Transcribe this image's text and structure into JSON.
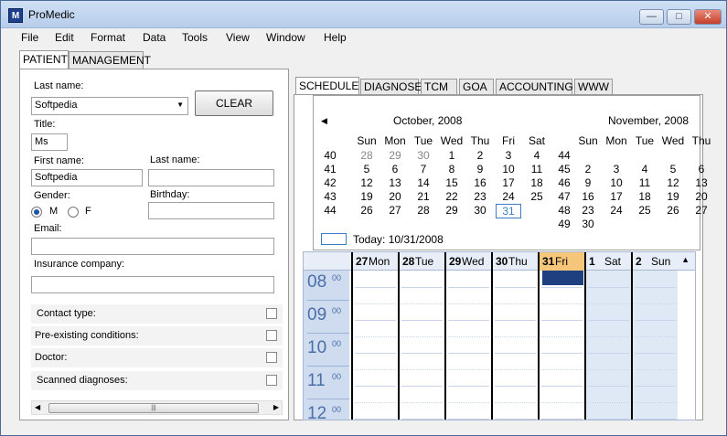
{
  "window": {
    "title": "ProMedic",
    "icon_letter": "M"
  },
  "menu": [
    "File",
    "Edit",
    "Format",
    "Data",
    "Tools",
    "View",
    "Window",
    "Help"
  ],
  "left_tabs": [
    "PATIENT",
    "MANAGEMENT"
  ],
  "patient": {
    "last_name_label": "Last name:",
    "last_name_value": "Softpedia",
    "clear_label": "CLEAR",
    "title_label": "Title:",
    "title_value": "Ms",
    "first_name_label": "First name:",
    "first_name_value": "Softpedia",
    "last_name2_label": "Last name:",
    "gender_label": "Gender:",
    "gender_m": "M",
    "gender_f": "F",
    "birthday_label": "Birthday:",
    "email_label": "Email:",
    "insurance_label": "Insurance company:",
    "contact_type": "Contact type:",
    "preexisting": "Pre-existing conditions:",
    "doctor": "Doctor:",
    "scanned": "Scanned diagnoses:"
  },
  "right_tabs": [
    "SCHEDULE",
    "DIAGNOSE",
    "TCM",
    "GOA",
    "ACCOUNTING",
    "WWW"
  ],
  "calendar": {
    "month1": "October, 2008",
    "month2": "November, 2008",
    "day_headers": [
      "Sun",
      "Mon",
      "Tue",
      "Wed",
      "Thu",
      "Fri",
      "Sat"
    ],
    "day_headers2": [
      "Sun",
      "Mon",
      "Tue",
      "Wed",
      "Thu"
    ],
    "today_text": "Today: 10/31/2008"
  },
  "schedule": {
    "days": [
      "27",
      "Mon",
      "28",
      "Tue",
      "29",
      "Wed",
      "30",
      "Thu",
      "31",
      "Fri",
      "1",
      "Sat",
      "2",
      "Sun"
    ],
    "hours": [
      "08",
      "09",
      "10",
      "11",
      "12"
    ],
    "minutes": "00"
  }
}
